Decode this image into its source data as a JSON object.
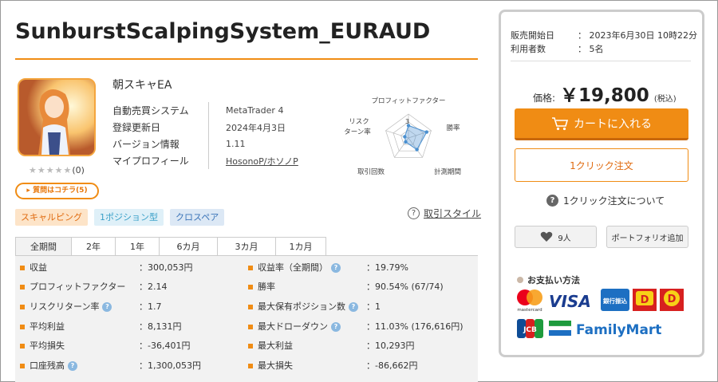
{
  "product": {
    "title": "SunburstScalpingSystem_EURAUD",
    "ea_name": "朝スキャEA",
    "stars": "★★★★★",
    "review_count": "(0)",
    "question_button": "▸ 質問はコチラ(5)",
    "info": [
      {
        "key": "自動売買システム",
        "value": "MetaTrader 4"
      },
      {
        "key": "登録更新日",
        "value": "2024年4月3日"
      },
      {
        "key": "バージョン情報",
        "value": "1.11"
      },
      {
        "key": "マイプロフィール",
        "value": "HosonoP/ホソノP"
      }
    ]
  },
  "radar": {
    "labels": {
      "top": "プロフィットファクター",
      "left1": "リスク",
      "left2": "ターン率",
      "right": "勝率",
      "bottom_left": "取引回数",
      "bottom_right": "計測期間"
    },
    "scale_label": "3",
    "values": [
      2.6,
      4.0,
      3.0,
      1.0,
      0.8
    ],
    "max": 5,
    "accent": "#4a90d0"
  },
  "tags": [
    "スキャルピング",
    "1ポジション型",
    "クロスペア"
  ],
  "trade_style_link": "取引スタイル",
  "tabs": [
    "全期間",
    "2年",
    "1年",
    "6カ月",
    "3カ月",
    "1カ月"
  ],
  "stats": {
    "left": [
      {
        "label": "収益",
        "value": "：300,053円",
        "help": false
      },
      {
        "label": "プロフィットファクター",
        "value": "：2.14",
        "help": false
      },
      {
        "label": "リスクリターン率",
        "value": "：1.7",
        "help": true
      },
      {
        "label": "平均利益",
        "value": "：8,131円",
        "help": false
      },
      {
        "label": "平均損失",
        "value": "：-36,401円",
        "help": false
      },
      {
        "label": "口座残高",
        "value": "：1,300,053円",
        "help": true
      }
    ],
    "right": [
      {
        "label": "収益率（全期間）",
        "value": "：19.79%",
        "help": true
      },
      {
        "label": "勝率",
        "value": "：90.54% (67/74)",
        "help": false
      },
      {
        "label": "最大保有ポジション数",
        "value": "：1",
        "help": true
      },
      {
        "label": "最大ドローダウン",
        "value": "：11.03% (176,616円)",
        "help": true
      },
      {
        "label": "最大利益",
        "value": "：10,293円",
        "help": false
      },
      {
        "label": "最大損失",
        "value": "：-86,662円",
        "help": false
      }
    ]
  },
  "sidebar": {
    "meta": [
      {
        "key": "販売開始日",
        "value": "：  2023年6月30日 10時22分"
      },
      {
        "key": "利用者数",
        "value": "：  5名"
      }
    ],
    "price_label": "価格:",
    "price_value": "￥19,800",
    "price_tax": "(税込)",
    "cart_button": "カートに入れる",
    "oneclick_button": "1クリック注文",
    "about_oneclick": "1クリック注文について",
    "like_count": "9人",
    "portfolio_button": "ポートフォリオ追加",
    "payment_title": "お支払い方法",
    "payment_logos": {
      "mastercard": "mastercard",
      "visa": "VISA",
      "bank": "銀行振込",
      "jcb": "JCB",
      "familymart": "FamilyMart"
    }
  },
  "colors": {
    "accent": "#f08c14",
    "help_icon": "#8ab8e0"
  }
}
